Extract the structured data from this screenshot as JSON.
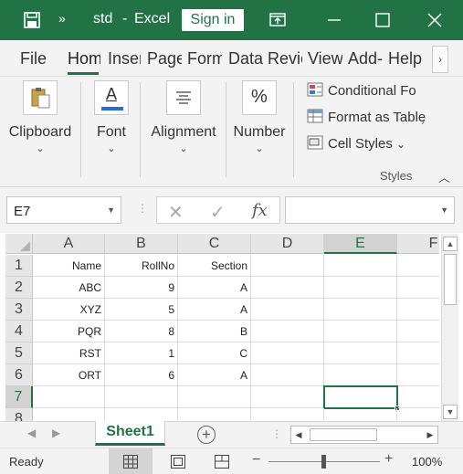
{
  "titlebar": {
    "more_glyph": "»",
    "doc_title": "std",
    "separator": "-",
    "app_name": "Excel",
    "sign_in": "Sign in"
  },
  "ribbon_tabs": [
    {
      "label": "File"
    },
    {
      "label": "Hom",
      "active": true
    },
    {
      "label": "Inser"
    },
    {
      "label": "Page"
    },
    {
      "label": "Form"
    },
    {
      "label": "Data"
    },
    {
      "label": "Revie"
    },
    {
      "label": "View"
    },
    {
      "label": "Add-"
    },
    {
      "label": "Help"
    }
  ],
  "ribbon": {
    "clipboard": "Clipboard",
    "font": "Font",
    "alignment": "Alignment",
    "number": "Number",
    "percent_glyph": "%",
    "font_glyph": "A",
    "conditional_formatting": "Conditional Fo",
    "format_as_table": "Format as Table",
    "cell_styles": "Cell Styles",
    "cell_styles_chevron": "⌄",
    "styles_group": "Styles",
    "chevron": "⌄"
  },
  "formula_bar": {
    "name_box": "E7",
    "fx": "fx",
    "formula": ""
  },
  "sheet": {
    "columns": [
      "A",
      "B",
      "C",
      "D",
      "E",
      "F"
    ],
    "selected_column": "E",
    "rows": [
      "1",
      "2",
      "3",
      "4",
      "5",
      "6",
      "7",
      "8"
    ],
    "selected_row": "7",
    "cells": {
      "r1": [
        "Name",
        "RollNo",
        "Section",
        "",
        ""
      ],
      "r2": [
        "ABC",
        "9",
        "A",
        "",
        ""
      ],
      "r3": [
        "XYZ",
        "5",
        "A",
        "",
        ""
      ],
      "r4": [
        "PQR",
        "8",
        "B",
        "",
        ""
      ],
      "r5": [
        "RST",
        "1",
        "C",
        "",
        ""
      ],
      "r6": [
        "ORT",
        "6",
        "A",
        "",
        ""
      ]
    }
  },
  "sheet_tabs": {
    "active": "Sheet1",
    "add": "+"
  },
  "status": {
    "ready": "Ready",
    "zoom": "100%",
    "zoom_fraction": 0.5
  },
  "colors": {
    "accent": "#217346"
  }
}
